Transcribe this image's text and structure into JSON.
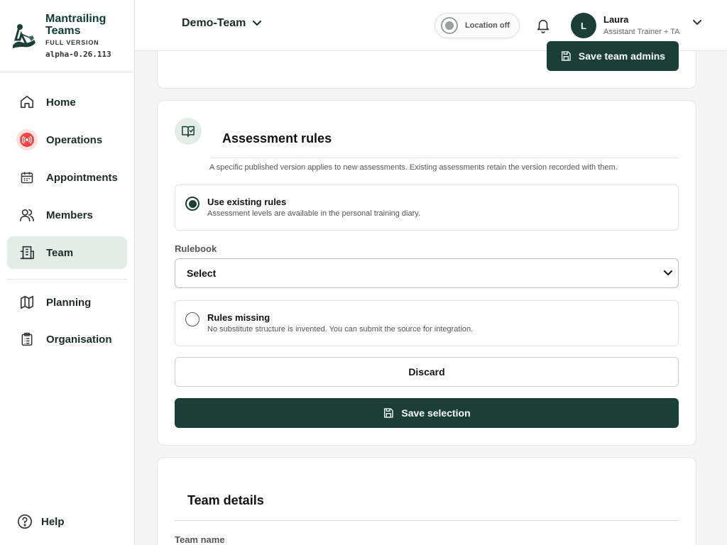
{
  "brand": {
    "name_line1": "Mantrailing",
    "name_line2": "Teams",
    "version": "FULL VERSION",
    "build": "alpha-0.26.113"
  },
  "sidebar": {
    "items": [
      {
        "label": "Home",
        "icon": "home-icon"
      },
      {
        "label": "Operations",
        "icon": "broadcast-icon"
      },
      {
        "label": "Appointments",
        "icon": "calendar-icon"
      },
      {
        "label": "Members",
        "icon": "users-icon"
      },
      {
        "label": "Team",
        "icon": "building-icon",
        "active": true
      },
      {
        "label": "Planning",
        "icon": "map-icon"
      },
      {
        "label": "Organisation",
        "icon": "clipboard-icon"
      }
    ],
    "help_label": "Help"
  },
  "header": {
    "team_name": "Demo-Team",
    "location_label": "Location off",
    "user": {
      "initial": "L",
      "name": "Laura",
      "role": "Assistant Trainer + TA"
    }
  },
  "top_card": {
    "save_admins_label": "Save team admins"
  },
  "assessment": {
    "title": "Assessment rules",
    "description": "A specific published version applies to new assessments. Existing assessments retain the version recorded with them.",
    "option_existing": {
      "title": "Use existing rules",
      "desc": "Assessment levels are available in the personal training diary.",
      "checked": true
    },
    "rulebook_label": "Rulebook",
    "rulebook_value": "Select",
    "option_missing": {
      "title": "Rules missing",
      "desc": "No substitute structure is invented. You can submit the source for integration.",
      "checked": false
    },
    "discard_label": "Discard",
    "save_label": "Save selection"
  },
  "details": {
    "title": "Team details",
    "team_name_label": "Team name"
  },
  "colors": {
    "primary": "#1b3f36",
    "active_bg": "#e3ede8",
    "alert": "#ef4444"
  }
}
